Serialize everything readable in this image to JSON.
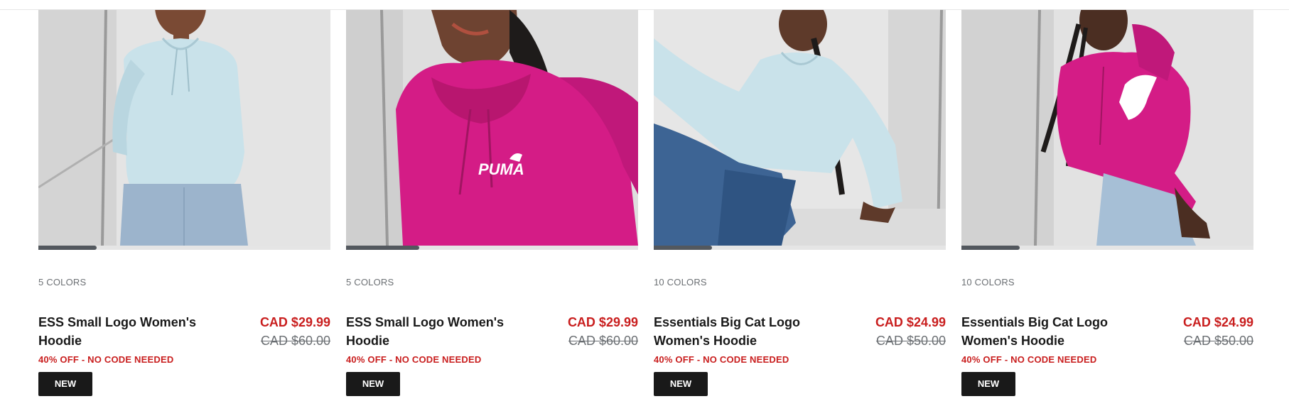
{
  "products": [
    {
      "colors": "5 COLORS",
      "name": "ESS Small Logo Women's Hoodie",
      "price_now": "CAD $29.99",
      "price_was": "CAD $60.00",
      "promo": "40% OFF - NO CODE NEEDED",
      "badge": "NEW",
      "image_alt": "Woman wearing light blue hoodie and jeans",
      "garment_color": "#c9e2ea",
      "carousel_progress": 0.2
    },
    {
      "colors": "5 COLORS",
      "name": "ESS Small Logo Women's Hoodie",
      "price_now": "CAD $29.99",
      "price_was": "CAD $60.00",
      "promo": "40% OFF - NO CODE NEEDED",
      "badge": "NEW",
      "image_alt": "Close-up of magenta PUMA hoodie",
      "garment_color": "#d41c86",
      "logo_text": "PUMA",
      "carousel_progress": 0.25
    },
    {
      "colors": "10 COLORS",
      "name": "Essentials Big Cat Logo Women's Hoodie",
      "price_now": "CAD $24.99",
      "price_was": "CAD $50.00",
      "promo": "40% OFF - NO CODE NEEDED",
      "badge": "NEW",
      "image_alt": "Woman sitting in light blue hoodie and jeans",
      "garment_color": "#c9e2ea",
      "carousel_progress": 0.2
    },
    {
      "colors": "10 COLORS",
      "name": "Essentials Big Cat Logo Women's Hoodie",
      "price_now": "CAD $24.99",
      "price_was": "CAD $50.00",
      "promo": "40% OFF - NO CODE NEEDED",
      "badge": "NEW",
      "image_alt": "Woman in magenta big cat logo hoodie",
      "garment_color": "#d41c86",
      "carousel_progress": 0.2
    }
  ],
  "colors": {
    "sale_red": "#c91e1e",
    "badge_bg": "#191919",
    "progress_track": "#e5e5e5",
    "progress_fill": "#53585e",
    "muted_text": "#6b6f73"
  }
}
